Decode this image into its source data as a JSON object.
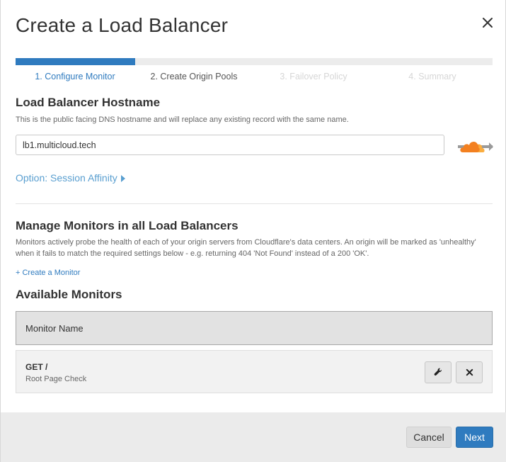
{
  "dialog": {
    "title": "Create a Load Balancer"
  },
  "wizard": {
    "progress": 0.25,
    "steps": [
      {
        "label": "1. Configure Monitor",
        "state": "active"
      },
      {
        "label": "2. Create Origin Pools",
        "state": "upcoming"
      },
      {
        "label": "3. Failover Policy",
        "state": "disabled"
      },
      {
        "label": "4. Summary",
        "state": "disabled"
      }
    ]
  },
  "hostname_section": {
    "title": "Load Balancer Hostname",
    "description": "This is the public facing DNS hostname and will replace any existing record with the same name.",
    "input_value": "lb1.multicloud.tech",
    "proxy_icon": "cloudflare-proxy-cloud-icon"
  },
  "session_affinity": {
    "label": "Option: Session Affinity"
  },
  "monitors_section": {
    "title": "Manage Monitors in all Load Balancers",
    "description": "Monitors actively probe the health of each of your origin servers from Cloudflare's data centers. An origin will be marked as 'unhealthy' when it fails to match the required settings below - e.g. returning 404 'Not Found' instead of a 200 'OK'.",
    "create_link": "+ Create a Monitor"
  },
  "available_monitors": {
    "title": "Available Monitors",
    "column_header": "Monitor Name",
    "rows": [
      {
        "name": "GET /",
        "description": "Root Page Check"
      }
    ]
  },
  "footer": {
    "cancel_label": "Cancel",
    "next_label": "Next"
  },
  "colors": {
    "accent": "#2f7bbf",
    "link": "#5a9fd0",
    "cloud_orange": "#f38020"
  }
}
